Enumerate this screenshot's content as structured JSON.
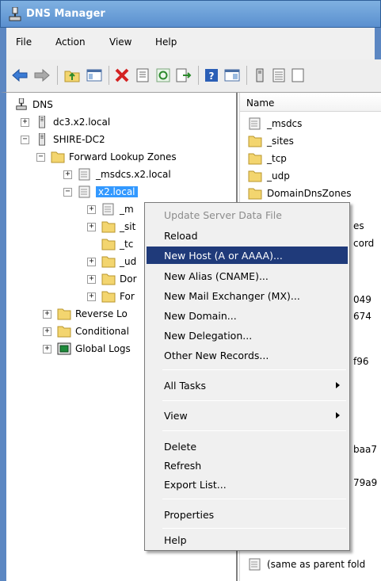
{
  "window": {
    "title": "DNS Manager"
  },
  "menubar": [
    "File",
    "Action",
    "View",
    "Help"
  ],
  "toolbar": [
    "back-arrow-icon",
    "forward-arrow-icon",
    "up-folder-icon",
    "show-hide-tree-icon",
    "delete-icon",
    "properties-icon",
    "refresh-icon",
    "export-list-icon",
    "help-icon",
    "console-icon",
    "server-icon",
    "list-icon"
  ],
  "tree": {
    "root": "DNS",
    "servers": [
      "dc3.x2.local",
      "SHIRE-DC2"
    ],
    "forward_zone": "Forward Lookup Zones",
    "msdcs_zone": "_msdcs.x2.local",
    "selected_zone": "x2.local",
    "children": [
      "_m",
      "_sit",
      "_tc",
      "_ud",
      "Dor",
      "For"
    ],
    "reverse": "Reverse Lo",
    "conditional": "Conditional",
    "global_logs": "Global Logs"
  },
  "list": {
    "header": "Name",
    "items": [
      "_msdcs",
      "_sites",
      "_tcp",
      "_udp",
      "DomainDnsZones"
    ],
    "fragments": [
      "es",
      "cord",
      "049",
      "674",
      "f96",
      "baa7",
      "79a9"
    ],
    "bottom_item": "(same as parent fold"
  },
  "context_menu": {
    "items": [
      {
        "label": "Update Server Data File",
        "disabled": true
      },
      {
        "label": "Reload"
      },
      {
        "label": "New Host (A or AAAA)...",
        "highlighted": true
      },
      {
        "label": "New Alias (CNAME)..."
      },
      {
        "label": "New Mail Exchanger (MX)..."
      },
      {
        "label": "New Domain..."
      },
      {
        "label": "New Delegation..."
      },
      {
        "label": "Other New Records..."
      },
      {
        "label": "All Tasks",
        "submenu": true
      },
      {
        "label": "View",
        "submenu": true
      },
      {
        "label": "Delete"
      },
      {
        "label": "Refresh"
      },
      {
        "label": "Export List..."
      },
      {
        "label": "Properties"
      },
      {
        "label": "Help"
      }
    ]
  },
  "colors": {
    "selection": "#3399ff",
    "menu_highlight": "#1f3a7a",
    "frame": "#5c87c2",
    "folder": "#f3d56f"
  }
}
